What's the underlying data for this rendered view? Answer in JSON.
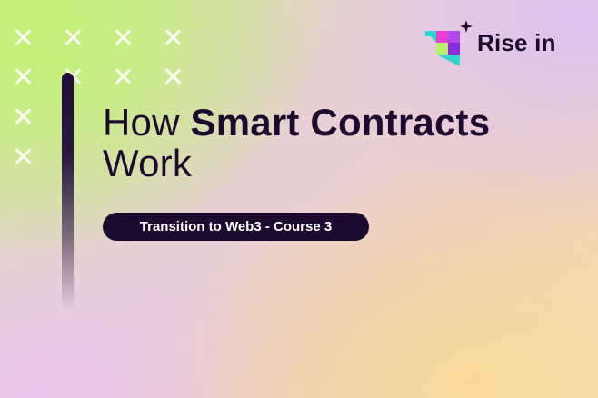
{
  "brand": {
    "name": "Rise in",
    "logo_icon": "rise-in-logo-icon",
    "colors": {
      "dark": "#1c0b2e",
      "mark_pink": "#e83fd0",
      "mark_violet": "#8a2be2",
      "mark_cyan": "#2fd6d0",
      "mark_lime": "#b8f06a"
    }
  },
  "headline": {
    "prefix": "How ",
    "emphasis": "Smart Contracts",
    "line2": "Work"
  },
  "badge": {
    "label": "Transition to Web3 - Course 3"
  },
  "decor": {
    "cross_icon": "cross-mark-icon",
    "sparkle_icon": "sparkle-icon"
  }
}
